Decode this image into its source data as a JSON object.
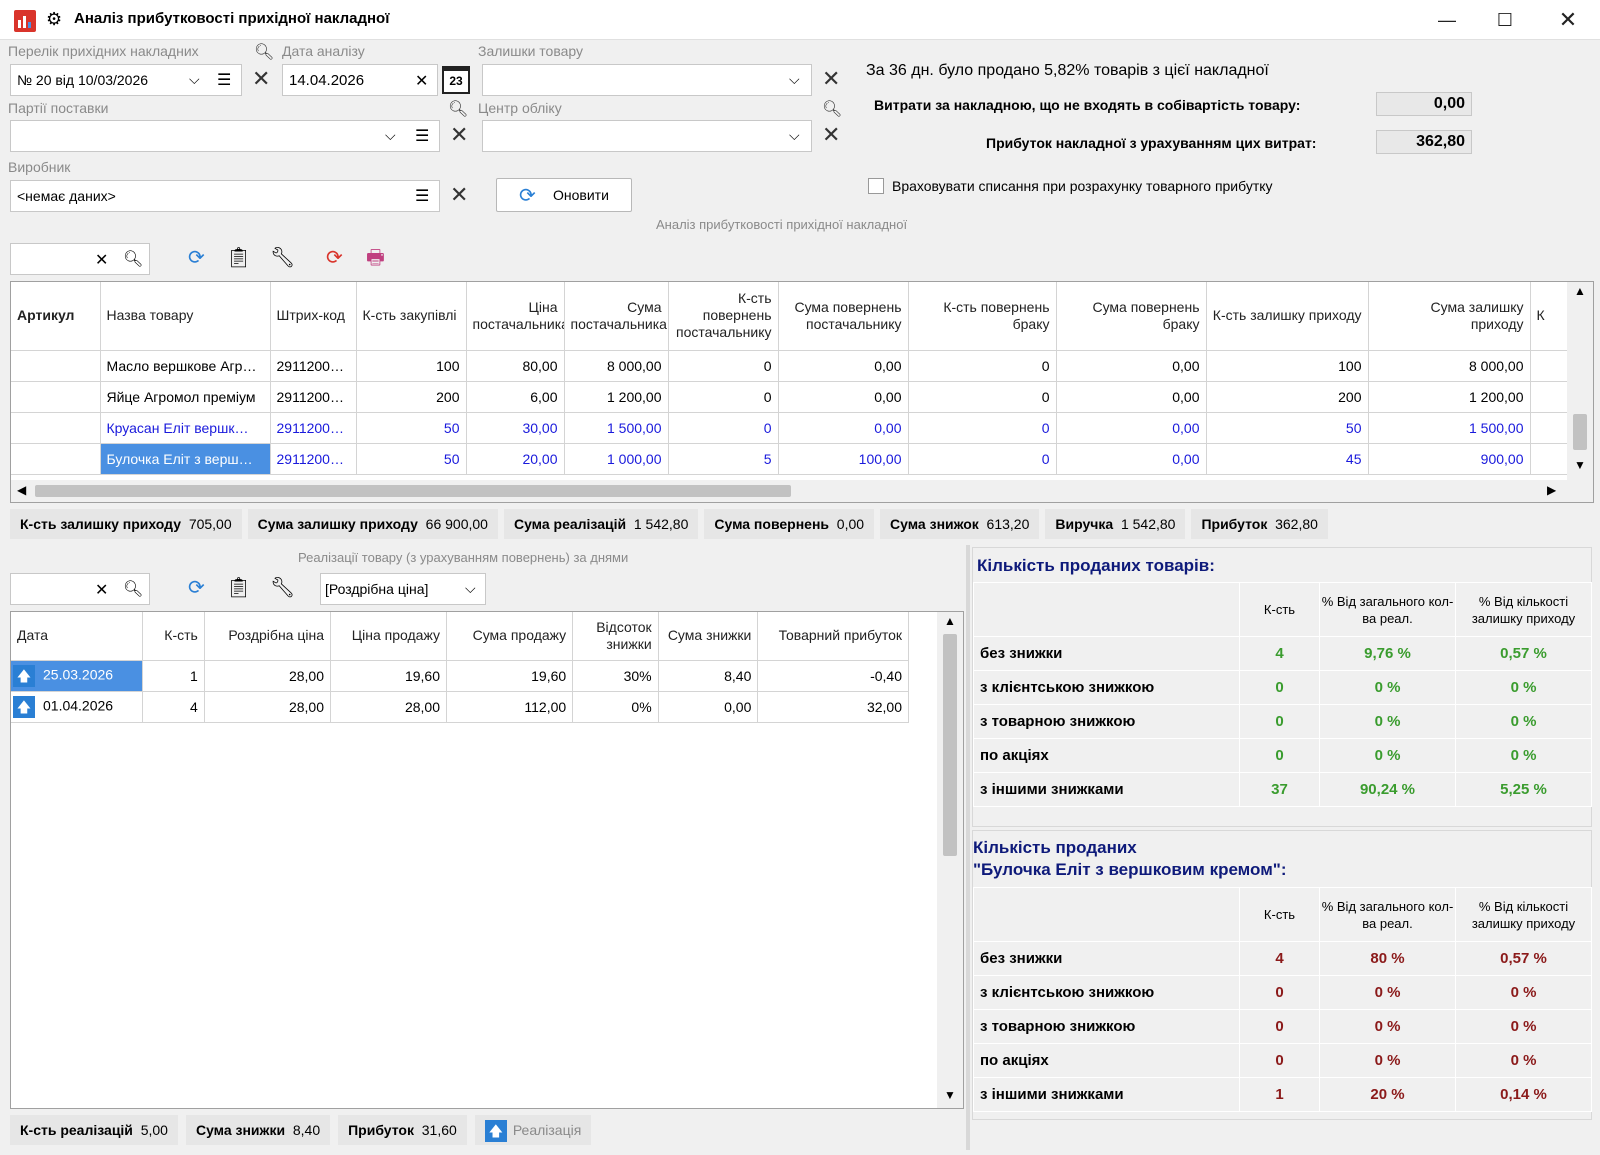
{
  "window": {
    "title": "Аналіз прибутковості прихідної накладної"
  },
  "filters": {
    "invoices_label": "Перелік прихідних накладних",
    "invoices_value": "№ 20 від 10/03/2026",
    "date_label": "Дата аналізу",
    "date_value": "14.04.2026",
    "date_icon_text": "23",
    "stock_label": "Залишки товару",
    "stock_value": "",
    "batches_label": "Партії поставки",
    "batches_value": "",
    "center_label": "Центр обліку",
    "center_value": "",
    "producer_label": "Виробник",
    "producer_value": "<немає даних>",
    "refresh_label": "Оновити"
  },
  "summary": {
    "sold_text": "За 36 дн. було продано 5,82% товарів з цієї накладної",
    "expenses_label": "Витрати за накладною, що не входять в собівартість товару:",
    "expenses_value": "0,00",
    "profit_label": "Прибуток накладної з урахуванням цих витрат:",
    "profit_value": "362,80",
    "writeoff_label": "Враховувати списання при розрахунку товарного прибутку"
  },
  "main_section_title": "Аналіз прибутковості прихідної накладної",
  "main_table": {
    "columns": [
      "Артикул",
      "Назва товару",
      "Штрих-код",
      "К-сть закупівлі",
      "Ціна постачальника",
      "Сума постачальника",
      "К-сть повернень постачальнику",
      "Сума повернень постачальнику",
      "К-сть повернень браку",
      "Сума повернень браку",
      "К-сть залишку приходу",
      "Сума залишку приходу",
      "К"
    ],
    "rows": [
      {
        "sku": "",
        "name": "Масло вершкове Агр…",
        "barcode": "2911200…",
        "qty": "100",
        "price": "80,00",
        "sum": "8 000,00",
        "ret_qty": "0",
        "ret_sum": "0,00",
        "def_qty": "0",
        "def_sum": "0,00",
        "rest_qty": "100",
        "rest_sum": "8 000,00"
      },
      {
        "sku": "",
        "name": "Яйце Агромол преміум",
        "barcode": "2911200…",
        "qty": "200",
        "price": "6,00",
        "sum": "1 200,00",
        "ret_qty": "0",
        "ret_sum": "0,00",
        "def_qty": "0",
        "def_sum": "0,00",
        "rest_qty": "200",
        "rest_sum": "1 200,00"
      },
      {
        "sku": "",
        "name": "Круасан Еліт вершк…",
        "barcode": "2911200…",
        "qty": "50",
        "price": "30,00",
        "sum": "1 500,00",
        "ret_qty": "0",
        "ret_sum": "0,00",
        "def_qty": "0",
        "def_sum": "0,00",
        "rest_qty": "50",
        "rest_sum": "1 500,00"
      },
      {
        "sku": "",
        "name": "Булочка Еліт з верш…",
        "barcode": "2911200…",
        "qty": "50",
        "price": "20,00",
        "sum": "1 000,00",
        "ret_qty": "5",
        "ret_sum": "100,00",
        "def_qty": "0",
        "def_sum": "0,00",
        "rest_qty": "45",
        "rest_sum": "900,00"
      }
    ]
  },
  "totals": [
    {
      "label": "К-сть залишку приходу",
      "value": "705,00"
    },
    {
      "label": "Сума залишку приходу",
      "value": "66 900,00"
    },
    {
      "label": "Сума реалізацій",
      "value": "1 542,80"
    },
    {
      "label": "Сума повернень",
      "value": "0,00"
    },
    {
      "label": "Сума знижок",
      "value": "613,20"
    },
    {
      "label": "Виручка",
      "value": "1 542,80"
    },
    {
      "label": "Прибуток",
      "value": "362,80"
    }
  ],
  "sales": {
    "title": "Реалізації товару (з урахуванням повернень) за днями",
    "price_type": "[Роздрібна ціна]",
    "columns": [
      "Дата",
      "К-сть",
      "Роздрібна ціна",
      "Ціна продажу",
      "Сума продажу",
      "Відсоток знижки",
      "Сума знижки",
      "Товарний прибуток"
    ],
    "rows": [
      {
        "date": "25.03.2026",
        "qty": "1",
        "retail": "28,00",
        "price": "19,60",
        "sum": "19,60",
        "pct": "30%",
        "disc": "8,40",
        "profit": "-0,40"
      },
      {
        "date": "01.04.2026",
        "qty": "4",
        "retail": "28,00",
        "price": "28,00",
        "sum": "112,00",
        "pct": "0%",
        "disc": "0,00",
        "profit": "32,00"
      }
    ],
    "footer": [
      {
        "label": "К-сть реалізацій",
        "value": "5,00"
      },
      {
        "label": "Сума знижки",
        "value": "8,40"
      },
      {
        "label": "Прибуток",
        "value": "31,60"
      }
    ],
    "legend_label": "Реалізація"
  },
  "stats1": {
    "title": "Кількість проданих товарів:",
    "col_qty": "К-сть",
    "col_pct_total": "% Від загального кол-ва реал.",
    "col_pct_rest": "% Від кількості залишку приходу",
    "rows": [
      {
        "label": "без знижки",
        "qty": "4",
        "p1": "9,76 %",
        "p2": "0,57 %"
      },
      {
        "label": "з клієнтською знижкою",
        "qty": "0",
        "p1": "0 %",
        "p2": "0 %"
      },
      {
        "label": "з товарною знижкою",
        "qty": "0",
        "p1": "0 %",
        "p2": "0 %"
      },
      {
        "label": "по акціях",
        "qty": "0",
        "p1": "0 %",
        "p2": "0 %"
      },
      {
        "label": "з іншими знижками",
        "qty": "37",
        "p1": "90,24 %",
        "p2": "5,25 %"
      }
    ]
  },
  "stats2": {
    "title_line1": "Кількість проданих",
    "title_line2": "\"Булочка Еліт з вершковим кремом\":",
    "col_qty": "К-сть",
    "col_pct_total": "% Від загального кол-ва реал.",
    "col_pct_rest": "% Від кількості залишку приходу",
    "rows": [
      {
        "label": "без знижки",
        "qty": "4",
        "p1": "80 %",
        "p2": "0,57 %"
      },
      {
        "label": "з клієнтською знижкою",
        "qty": "0",
        "p1": "0 %",
        "p2": "0 %"
      },
      {
        "label": "з товарною знижкою",
        "qty": "0",
        "p1": "0 %",
        "p2": "0 %"
      },
      {
        "label": "по акціях",
        "qty": "0",
        "p1": "0 %",
        "p2": "0 %"
      },
      {
        "label": "з іншими знижками",
        "qty": "1",
        "p1": "20 %",
        "p2": "0,14 %"
      }
    ]
  },
  "colors": {
    "accent": "#4a90e2",
    "green": "#3a9c2e",
    "dark_red": "#8b1a1a",
    "navy": "#0e1a7a",
    "link_blue": "#1a1adc"
  }
}
